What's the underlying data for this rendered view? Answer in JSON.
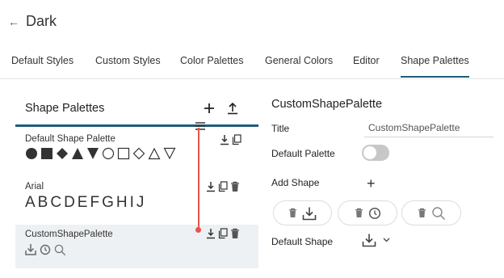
{
  "header": {
    "back_icon": "arrow-left-icon",
    "title": "Dark"
  },
  "tabs": [
    {
      "label": "Default Styles",
      "active": false
    },
    {
      "label": "Custom Styles",
      "active": false
    },
    {
      "label": "Color Palettes",
      "active": false
    },
    {
      "label": "General Colors",
      "active": false
    },
    {
      "label": "Editor",
      "active": false
    },
    {
      "label": "Shape Palettes",
      "active": true
    }
  ],
  "left_panel": {
    "title": "Shape Palettes",
    "add_icon": "plus-icon",
    "upload_icon": "upload-icon",
    "palettes": [
      {
        "name": "Default Shape Palette",
        "shapes": [
          "circle-filled",
          "square-filled",
          "diamond-filled",
          "triangle-up-filled",
          "triangle-down-filled",
          "circle-outline",
          "square-outline",
          "diamond-outline",
          "triangle-up-outline",
          "triangle-down-outline"
        ],
        "actions": [
          "download-icon",
          "copy-icon"
        ]
      },
      {
        "name": "Arial",
        "preview_text": "ABCDEFGHIJ",
        "actions": [
          "download-icon",
          "copy-icon",
          "trash-icon"
        ]
      },
      {
        "name": "CustomShapePalette",
        "shapes": [
          "download-icon",
          "clock-icon",
          "search-icon"
        ],
        "actions": [
          "download-icon",
          "copy-icon",
          "trash-icon"
        ],
        "selected": true
      }
    ]
  },
  "right_panel": {
    "title": "CustomShapePalette",
    "title_label": "Title",
    "title_value": "CustomShapePalette",
    "default_palette_label": "Default Palette",
    "default_palette_enabled": false,
    "add_shape_label": "Add Shape",
    "shapes": [
      {
        "icons": [
          "trash-icon",
          "download-icon"
        ]
      },
      {
        "icons": [
          "trash-icon",
          "clock-icon"
        ]
      },
      {
        "icons": [
          "trash-icon",
          "search-icon"
        ]
      }
    ],
    "default_shape_label": "Default Shape",
    "default_shape_icon": "download-icon"
  },
  "colors": {
    "accent": "#1f5c7a",
    "connector": "#e8544a",
    "selected_row": "#eef1f4",
    "toggle_off": "#c7c7c7"
  }
}
